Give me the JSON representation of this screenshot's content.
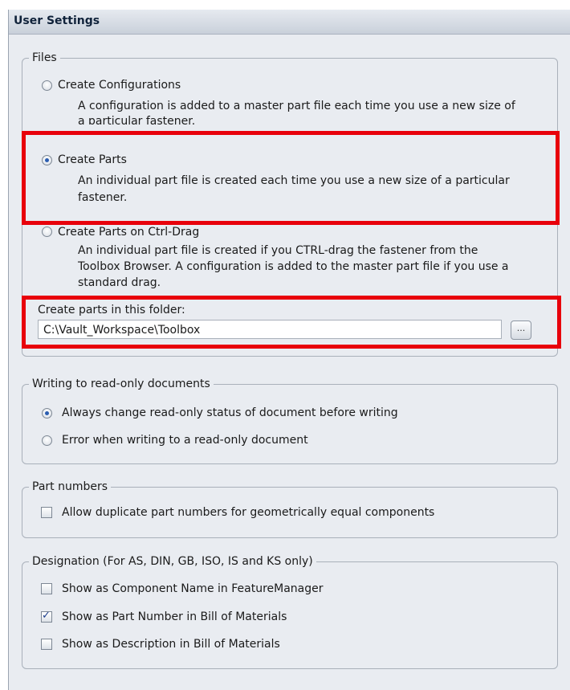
{
  "title": "User Settings",
  "files": {
    "legend": "Files",
    "create_configurations": {
      "label": "Create Configurations",
      "desc_line1": "A configuration is added to a master part file each time you use a new size of",
      "desc_line2": "a particular fastener.",
      "selected": false
    },
    "create_parts": {
      "label": "Create Parts",
      "desc_line1": "An individual part file is created each time you use a new size of a particular",
      "desc_line2": "fastener.",
      "selected": true
    },
    "create_parts_ctrl_drag": {
      "label": "Create Parts on Ctrl-Drag",
      "desc_line1": "An individual part file is created if you CTRL-drag the fastener from the",
      "desc_line2": "Toolbox Browser. A configuration is added to the master part file if you use a",
      "desc_line3": "standard drag.",
      "selected": false
    },
    "folder_label": "Create parts in this folder:",
    "folder_value": "C:\\Vault_Workspace\\Toolbox",
    "browse_label": "..."
  },
  "read_only": {
    "legend": "Writing to read-only documents",
    "always_change": {
      "label": "Always change read-only status of document before writing",
      "selected": true
    },
    "error_when_writing": {
      "label": "Error when writing to a read-only document",
      "selected": false
    }
  },
  "part_numbers": {
    "legend": "Part numbers",
    "allow_duplicate": {
      "label": "Allow duplicate part numbers for geometrically equal components",
      "checked": false
    }
  },
  "designation": {
    "legend": "Designation (For AS, DIN, GB, ISO, IS and KS only)",
    "component_name": {
      "label": "Show as Component Name in FeatureManager",
      "checked": false
    },
    "part_number_bom": {
      "label": "Show as Part Number in Bill of Materials",
      "checked": true
    },
    "description_bom": {
      "label": "Show as Description in Bill of Materials",
      "checked": false
    }
  },
  "colors": {
    "highlight": "#e8000b",
    "panel": "#e9ecf1",
    "title_text": "#10223a"
  }
}
